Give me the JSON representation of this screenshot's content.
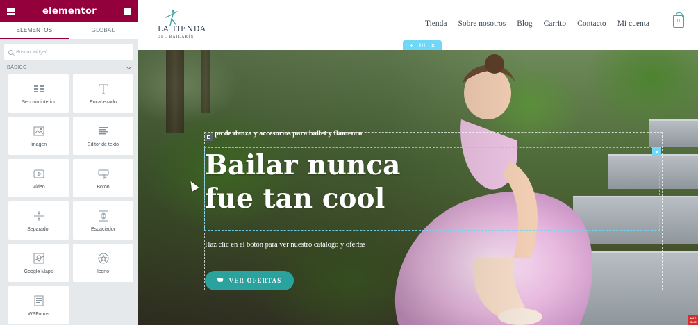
{
  "panel": {
    "logo": "elementor",
    "tabs": [
      "ELEMENTOS",
      "GLOBAL"
    ],
    "search_placeholder": "Buscar widget...",
    "category": "BÁSICO",
    "widgets": [
      {
        "label": "Sección interior",
        "icon": "columns-icon"
      },
      {
        "label": "Encabezado",
        "icon": "heading-icon"
      },
      {
        "label": "Imagen",
        "icon": "image-icon"
      },
      {
        "label": "Editor de texto",
        "icon": "text-editor-icon"
      },
      {
        "label": "Vídeo",
        "icon": "video-icon"
      },
      {
        "label": "Botón",
        "icon": "button-icon"
      },
      {
        "label": "Separador",
        "icon": "divider-icon"
      },
      {
        "label": "Espaciador",
        "icon": "spacer-icon"
      },
      {
        "label": "Google Maps",
        "icon": "map-icon"
      },
      {
        "label": "Icono",
        "icon": "star-icon"
      },
      {
        "label": "WPForms",
        "icon": "form-icon"
      }
    ]
  },
  "site": {
    "brand": {
      "name": "LA TIENDA",
      "sub": "DEL BAILARÍN"
    },
    "nav": [
      "Tienda",
      "Sobre nosotros",
      "Blog",
      "Carrito",
      "Contacto",
      "Mi cuenta"
    ],
    "cart_count": "0"
  },
  "hero": {
    "eyebrow": "pa de danza y accesorios para ballet y flamenco",
    "headline": "Bailar nunca fue tan cool",
    "subtext": "Haz clic en el botón para ver nuestro catálogo y ofertas",
    "cta_label": "VER OFERTAS"
  },
  "colors": {
    "elementor_brand": "#93003c",
    "accent": "#2aa39f",
    "editor_handle": "#71d7f7"
  }
}
